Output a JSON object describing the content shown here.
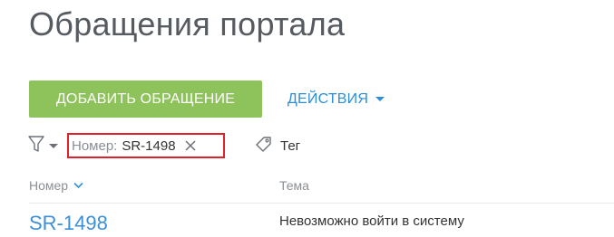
{
  "page": {
    "title": "Обращения портала"
  },
  "toolbar": {
    "add_label": "ДОБАВИТЬ ОБРАЩЕНИЕ",
    "actions_label": "ДЕЙСТВИЯ"
  },
  "filter": {
    "icon": "funnel-icon",
    "active_tag": {
      "key": "Номер:",
      "value": "SR-1498"
    },
    "tag_control_label": "Тег"
  },
  "table": {
    "columns": [
      {
        "label": "Номер",
        "sorted": true
      },
      {
        "label": "Тема"
      }
    ],
    "rows": [
      {
        "number": "SR-1498",
        "topic": "Невозможно войти в систему"
      }
    ]
  },
  "colors": {
    "add_button": "#8ec35b",
    "link": "#2f8fd6",
    "highlight": "#e0202b"
  }
}
